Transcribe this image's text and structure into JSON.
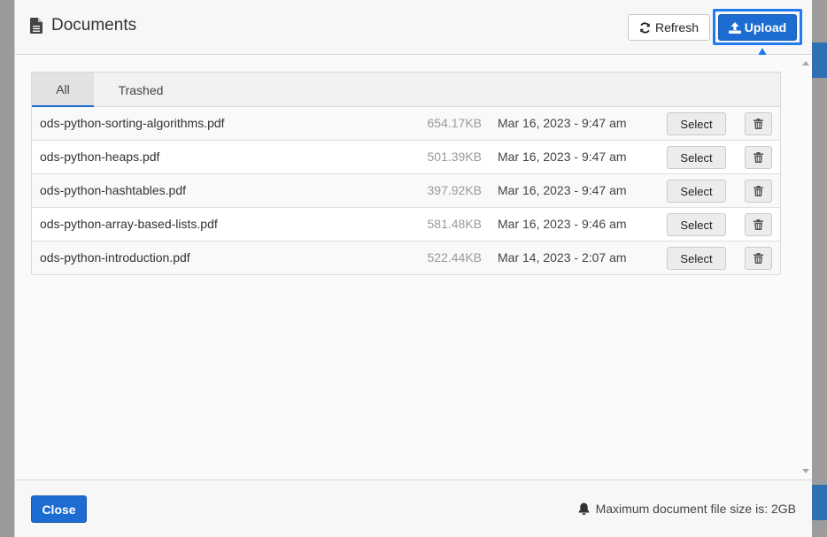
{
  "header": {
    "title": "Documents",
    "icon": "file-icon",
    "refresh_label": "Refresh",
    "upload_label": "Upload"
  },
  "tabs": [
    {
      "label": "All",
      "active": true
    },
    {
      "label": "Trashed",
      "active": false
    }
  ],
  "documents": [
    {
      "name": "ods-python-sorting-algorithms.pdf",
      "size": "654.17KB",
      "date": "Mar 16, 2023 - 9:47 am",
      "select_label": "Select"
    },
    {
      "name": "ods-python-heaps.pdf",
      "size": "501.39KB",
      "date": "Mar 16, 2023 - 9:47 am",
      "select_label": "Select"
    },
    {
      "name": "ods-python-hashtables.pdf",
      "size": "397.92KB",
      "date": "Mar 16, 2023 - 9:47 am",
      "select_label": "Select"
    },
    {
      "name": "ods-python-array-based-lists.pdf",
      "size": "581.48KB",
      "date": "Mar 16, 2023 - 9:46 am",
      "select_label": "Select"
    },
    {
      "name": "ods-python-introduction.pdf",
      "size": "522.44KB",
      "date": "Mar 14, 2023 - 2:07 am",
      "select_label": "Select"
    }
  ],
  "footer": {
    "close_label": "Close",
    "limit_text": "Maximum document file size is: 2GB"
  },
  "colors": {
    "primary": "#1c6cd1",
    "highlight": "#1e7cf0"
  }
}
